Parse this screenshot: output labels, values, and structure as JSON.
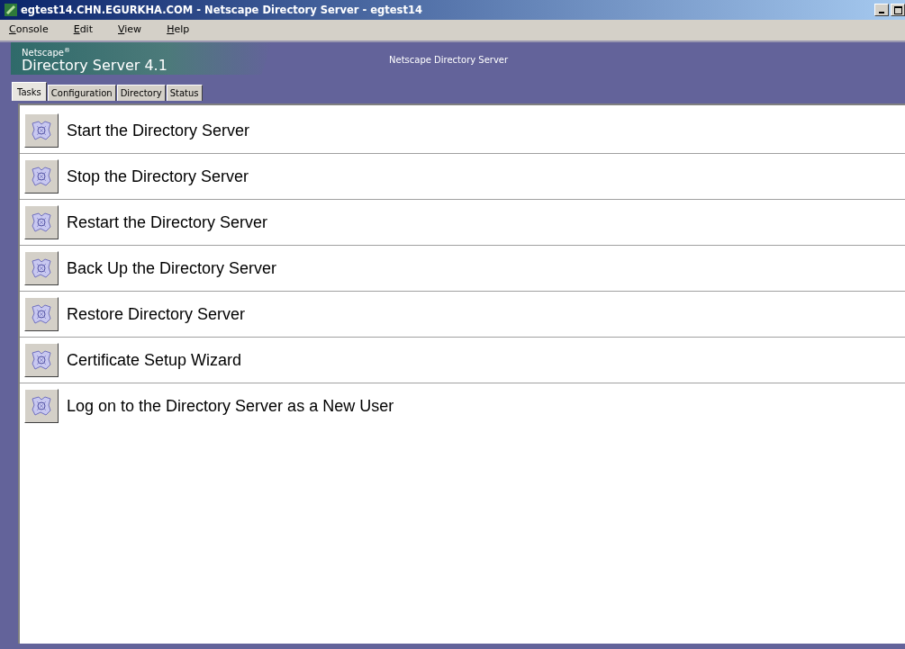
{
  "window": {
    "title": "egtest14.CHN.EGURKHA.COM - Netscape Directory Server - egtest14"
  },
  "menu": [
    "Console",
    "Edit",
    "View",
    "Help"
  ],
  "banner": {
    "brand": "Netscape",
    "registered": "®",
    "product": "Directory Server 4.1",
    "caption": "Netscape Directory Server"
  },
  "tabs": [
    {
      "label": "Tasks",
      "selected": true
    },
    {
      "label": "Configuration",
      "selected": false
    },
    {
      "label": "Directory",
      "selected": false
    },
    {
      "label": "Status",
      "selected": false
    }
  ],
  "tasks": [
    "Start the Directory Server",
    "Stop the Directory Server",
    "Restart the Directory Server",
    "Back Up the Directory Server",
    "Restore Directory Server",
    "Certificate Setup Wizard",
    "Log on to the Directory Server as a New User"
  ]
}
